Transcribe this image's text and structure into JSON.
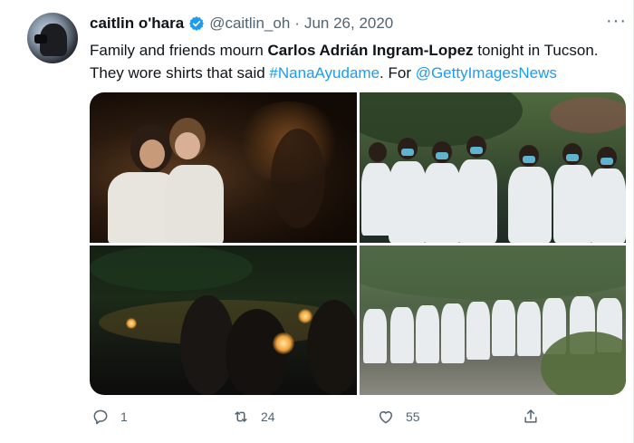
{
  "user": {
    "name": "caitlin o'hara",
    "handle": "@caitlin_oh",
    "separator": "·",
    "date": "Jun 26, 2020"
  },
  "more_label": "···",
  "tweet": {
    "text_1": "Family and friends mourn ",
    "bold": "Carlos Adrián Ingram-Lopez",
    "text_2": " tonight in Tucson. They wore shirts that said ",
    "hashtag": "#NanaAyudame",
    "text_3": ". For ",
    "mention": "@GettyImagesNews"
  },
  "actions": {
    "reply_count": "1",
    "retweet_count": "24",
    "like_count": "55"
  },
  "colors": {
    "link": "#1d9bf0",
    "verified": "#1d9bf0",
    "secondary_text": "#536471"
  },
  "icons": [
    "verified-badge-icon",
    "more-icon",
    "reply-icon",
    "retweet-icon",
    "like-icon",
    "share-icon"
  ]
}
